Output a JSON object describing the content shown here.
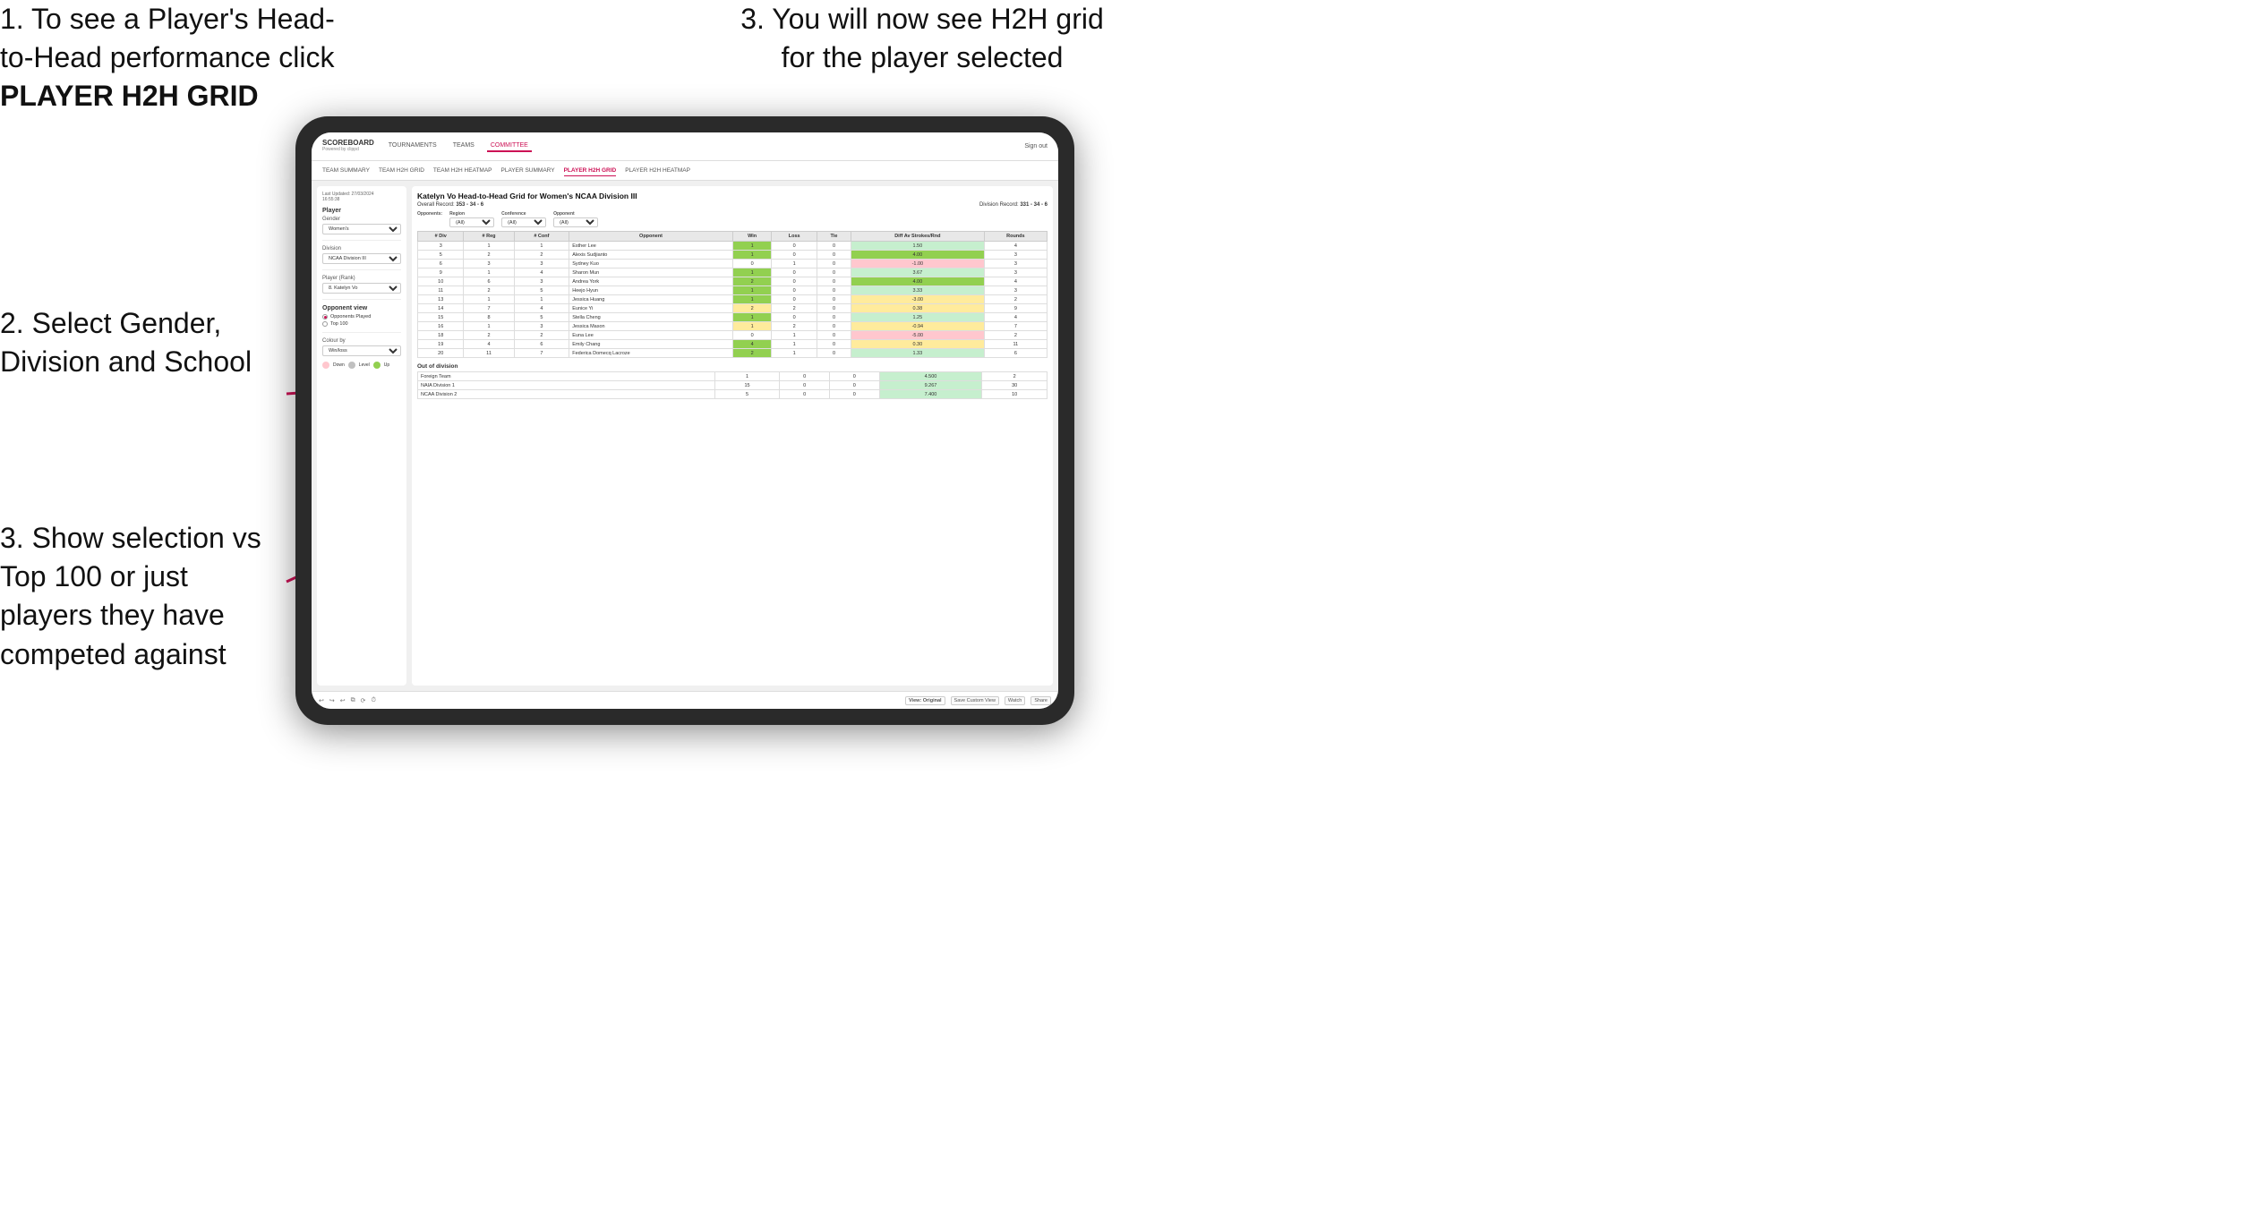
{
  "instructions": {
    "top_left": "1. To see a Player's Head-to-Head performance click",
    "top_left_bold": "PLAYER H2H GRID",
    "top_right_line1": "3. You will now see H2H grid",
    "top_right_line2": "for the player selected",
    "mid_left": "2. Select Gender, Division and School",
    "bottom_left_line1": "3. Show selection vs Top 100 or just players they have competed against"
  },
  "navbar": {
    "logo": "SCOREBOARD",
    "logo_sub": "Powered by clippd",
    "nav_items": [
      "TOURNAMENTS",
      "TEAMS",
      "COMMITTEE"
    ],
    "active_nav": "COMMITTEE",
    "sign_out": "Sign out"
  },
  "subnav": {
    "items": [
      "TEAM SUMMARY",
      "TEAM H2H GRID",
      "TEAM H2H HEATMAP",
      "PLAYER SUMMARY",
      "PLAYER H2H GRID",
      "PLAYER H2H HEATMAP"
    ],
    "active": "PLAYER H2H GRID"
  },
  "left_panel": {
    "last_updated": "Last Updated: 27/03/2024",
    "time": "16:55:38",
    "player_label": "Player",
    "gender_label": "Gender",
    "gender_value": "Women's",
    "division_label": "Division",
    "division_value": "NCAA Division III",
    "player_rank_label": "Player (Rank)",
    "player_rank_value": "8. Katelyn Vo",
    "opponent_view_label": "Opponent view",
    "opponent_options": [
      "Opponents Played",
      "Top 100"
    ],
    "selected_opponent": "Opponents Played",
    "colour_by_label": "Colour by",
    "colour_by_value": "Win/loss",
    "legend_labels": [
      "Down",
      "Level",
      "Up"
    ]
  },
  "grid": {
    "title": "Katelyn Vo Head-to-Head Grid for Women's NCAA Division III",
    "overall_record": "353 - 34 - 6",
    "division_record": "331 - 34 - 6",
    "filters": {
      "region_label": "Region",
      "region_value": "(All)",
      "conference_label": "Conference",
      "conference_value": "(All)",
      "opponent_label": "Opponent",
      "opponent_value": "(All)",
      "opponents_label": "Opponents:"
    },
    "table_headers": [
      "# Div",
      "# Reg",
      "# Conf",
      "Opponent",
      "Win",
      "Loss",
      "Tie",
      "Diff Av Strokes/Rnd",
      "Rounds"
    ],
    "rows": [
      {
        "div": 3,
        "reg": 1,
        "conf": 1,
        "opponent": "Esther Lee",
        "win": 1,
        "loss": 0,
        "tie": 0,
        "diff": 1.5,
        "rounds": 4,
        "win_color": "green",
        "diff_color": "light-green"
      },
      {
        "div": 5,
        "reg": 2,
        "conf": 2,
        "opponent": "Alexis Sudjianto",
        "win": 1,
        "loss": 0,
        "tie": 0,
        "diff": 4.0,
        "rounds": 3,
        "win_color": "green",
        "diff_color": "green"
      },
      {
        "div": 6,
        "reg": 3,
        "conf": 3,
        "opponent": "Sydney Kuo",
        "win": 0,
        "loss": 1,
        "tie": 0,
        "diff": -1.0,
        "rounds": 3,
        "win_color": "white",
        "diff_color": "red"
      },
      {
        "div": 9,
        "reg": 1,
        "conf": 4,
        "opponent": "Sharon Mun",
        "win": 1,
        "loss": 0,
        "tie": 0,
        "diff": 3.67,
        "rounds": 3,
        "win_color": "green",
        "diff_color": "light-green"
      },
      {
        "div": 10,
        "reg": 6,
        "conf": 3,
        "opponent": "Andrea York",
        "win": 2,
        "loss": 0,
        "tie": 0,
        "diff": 4.0,
        "rounds": 4,
        "win_color": "green",
        "diff_color": "green"
      },
      {
        "div": 11,
        "reg": 2,
        "conf": 5,
        "opponent": "Heejo Hyun",
        "win": 1,
        "loss": 0,
        "tie": 0,
        "diff": 3.33,
        "rounds": 3,
        "win_color": "green",
        "diff_color": "light-green"
      },
      {
        "div": 13,
        "reg": 1,
        "conf": 1,
        "opponent": "Jessica Huang",
        "win": 1,
        "loss": 0,
        "tie": 0,
        "diff": -3.0,
        "rounds": 2,
        "win_color": "green",
        "diff_color": "yellow"
      },
      {
        "div": 14,
        "reg": 7,
        "conf": 4,
        "opponent": "Eunice Yi",
        "win": 2,
        "loss": 2,
        "tie": 0,
        "diff": 0.38,
        "rounds": 9,
        "win_color": "yellow",
        "diff_color": "yellow"
      },
      {
        "div": 15,
        "reg": 8,
        "conf": 5,
        "opponent": "Stella Cheng",
        "win": 1,
        "loss": 0,
        "tie": 0,
        "diff": 1.25,
        "rounds": 4,
        "win_color": "green",
        "diff_color": "light-green"
      },
      {
        "div": 16,
        "reg": 1,
        "conf": 3,
        "opponent": "Jessica Mason",
        "win": 1,
        "loss": 2,
        "tie": 0,
        "diff": -0.94,
        "rounds": 7,
        "win_color": "yellow",
        "diff_color": "yellow"
      },
      {
        "div": 18,
        "reg": 2,
        "conf": 2,
        "opponent": "Euna Lee",
        "win": 0,
        "loss": 1,
        "tie": 0,
        "diff": -5.0,
        "rounds": 2,
        "win_color": "white",
        "diff_color": "red"
      },
      {
        "div": 19,
        "reg": 4,
        "conf": 6,
        "opponent": "Emily Chang",
        "win": 4,
        "loss": 1,
        "tie": 0,
        "diff": 0.3,
        "rounds": 11,
        "win_color": "green",
        "diff_color": "yellow"
      },
      {
        "div": 20,
        "reg": 11,
        "conf": 7,
        "opponent": "Federica Domecq Lacroze",
        "win": 2,
        "loss": 1,
        "tie": 0,
        "diff": 1.33,
        "rounds": 6,
        "win_color": "green",
        "diff_color": "light-green"
      }
    ],
    "out_of_division_label": "Out of division",
    "out_of_division_rows": [
      {
        "label": "Foreign Team",
        "win": 1,
        "loss": 0,
        "tie": 0,
        "diff": 4.5,
        "rounds": 2
      },
      {
        "label": "NAIA Division 1",
        "win": 15,
        "loss": 0,
        "tie": 0,
        "diff": 9.267,
        "rounds": 30
      },
      {
        "label": "NCAA Division 2",
        "win": 5,
        "loss": 0,
        "tie": 0,
        "diff": 7.4,
        "rounds": 10
      }
    ]
  },
  "toolbar": {
    "buttons": [
      "View: Original",
      "Save Custom View",
      "Watch",
      "Share"
    ]
  }
}
